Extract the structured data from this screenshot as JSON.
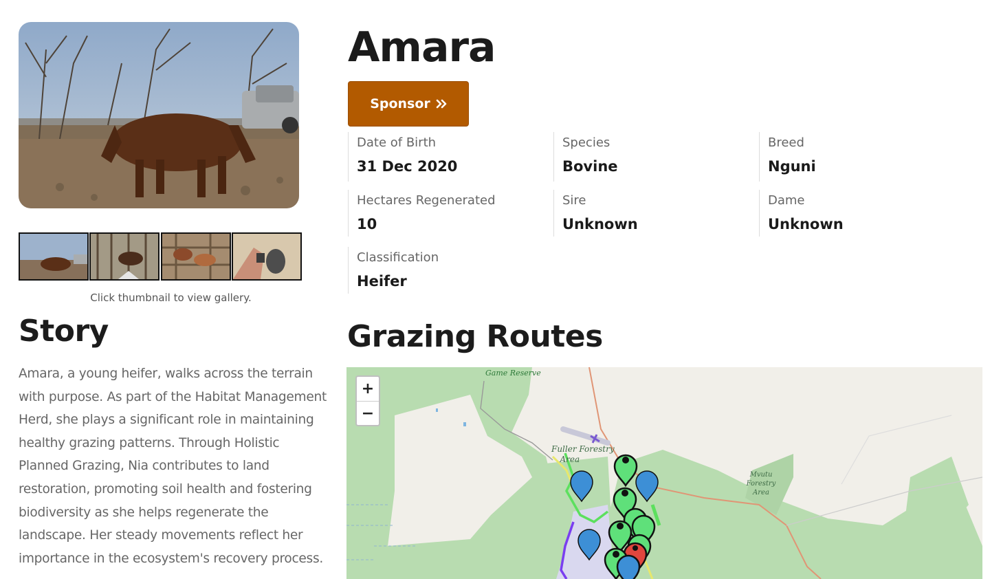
{
  "animal": {
    "name": "Amara",
    "sponsor_label": "Sponsor",
    "sponsor_icon": "double-chevron-right-icon"
  },
  "gallery": {
    "caption": "Click thumbnail to view gallery.",
    "thumbnails": 4
  },
  "details": [
    {
      "label": "Date of Birth",
      "value": "31 Dec 2020"
    },
    {
      "label": "Species",
      "value": "Bovine"
    },
    {
      "label": "Breed",
      "value": "Nguni"
    },
    {
      "label": "Hectares Regenerated",
      "value": "10"
    },
    {
      "label": "Sire",
      "value": "Unknown"
    },
    {
      "label": "Dame",
      "value": "Unknown"
    },
    {
      "label": "Classification",
      "value": "Heifer"
    }
  ],
  "story": {
    "title": "Story",
    "text": "Amara, a young heifer, walks across the terrain with purpose. As part of the Habitat Management Herd, she plays a significant role in maintaining healthy grazing patterns. Through Holistic Planned Grazing, Nia contributes to land restoration, promoting soil health and fostering biodiversity as she helps regenerate the landscape. Her steady movements reflect her importance in the ecosystem's recovery process."
  },
  "routes": {
    "title": "Grazing Routes",
    "zoom_in": "+",
    "zoom_out": "−",
    "map_labels": {
      "game_reserve": "Game Reserve",
      "fuller_line1": "Fuller Forestry",
      "fuller_line2": "Area",
      "mvutu_line1": "Mvutu",
      "mvutu_line2": "Forestry",
      "mvutu_line3": "Area"
    }
  },
  "colors": {
    "accent": "#b25a00",
    "marker_green": "#5fe07a",
    "marker_blue": "#3d8fd6",
    "marker_red": "#e0463e",
    "map_forest": "#b8dcb0"
  }
}
